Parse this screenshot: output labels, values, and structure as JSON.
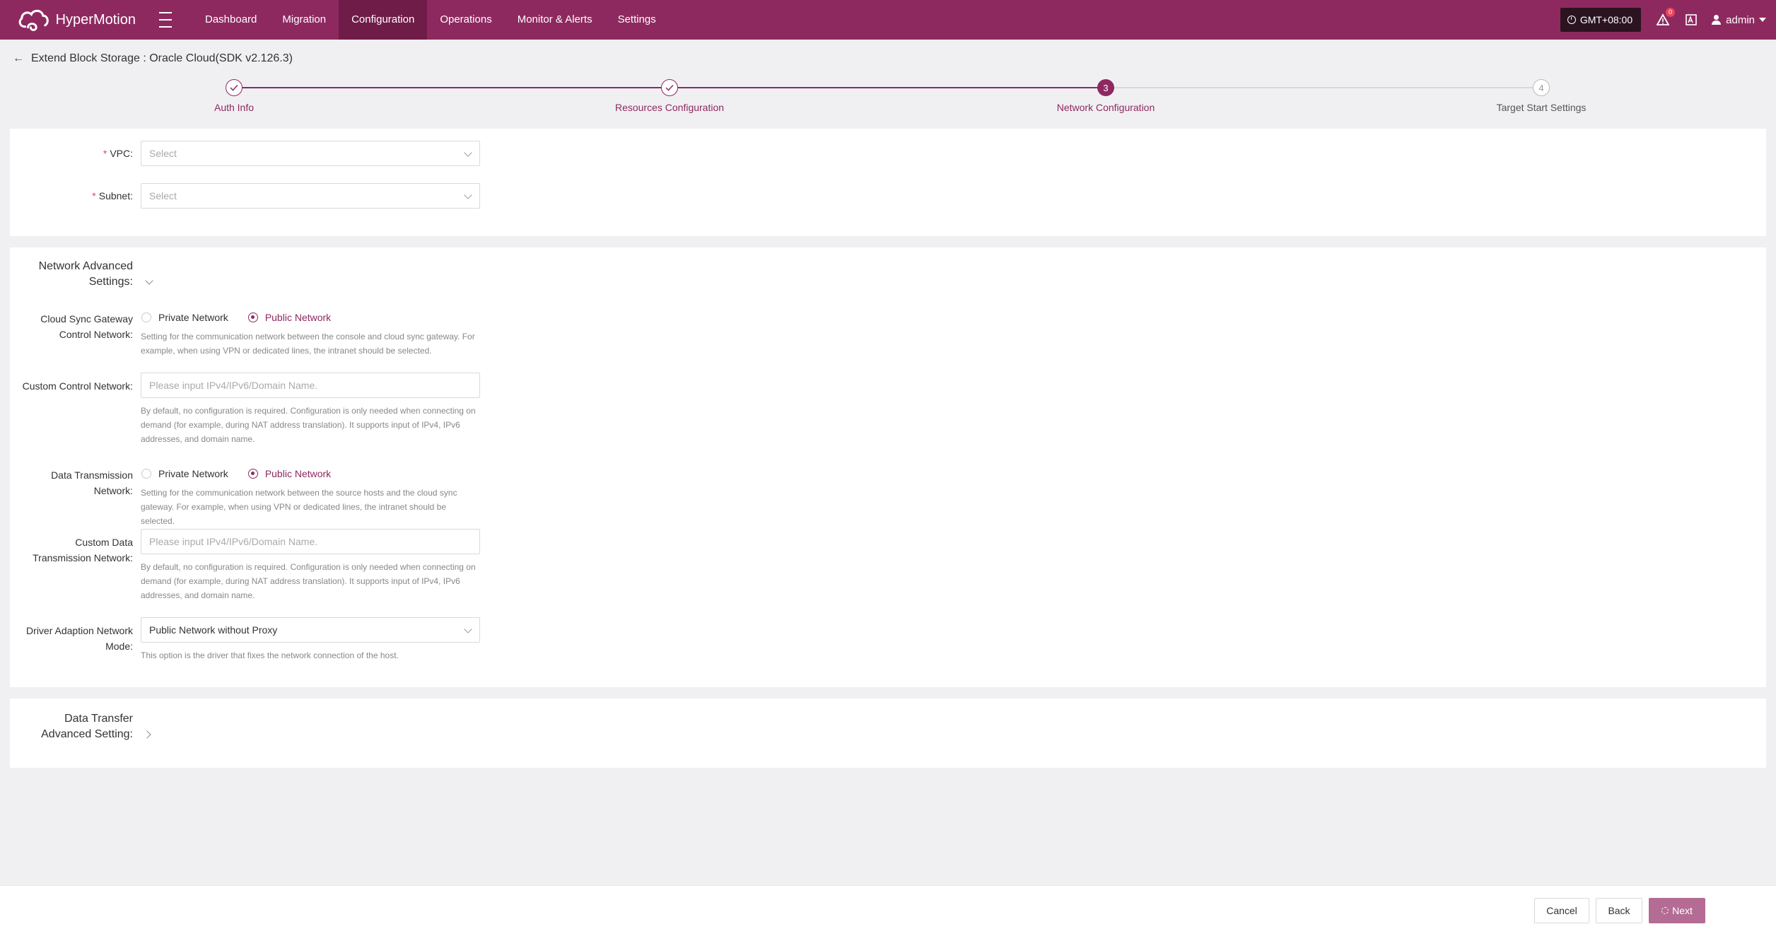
{
  "app": {
    "name": "HyperMotion"
  },
  "nav": {
    "items": [
      {
        "label": "Dashboard"
      },
      {
        "label": "Migration"
      },
      {
        "label": "Configuration"
      },
      {
        "label": "Operations"
      },
      {
        "label": "Monitor & Alerts"
      },
      {
        "label": "Settings"
      }
    ],
    "active": "Configuration"
  },
  "topbar": {
    "timezone": "GMT+08:00",
    "alert_count": "0",
    "user": "admin",
    "lang_icon": "A"
  },
  "page": {
    "title": "Extend Block Storage : Oracle Cloud(SDK v2.126.3)"
  },
  "steps": [
    {
      "number": "1",
      "label": "Auth Info",
      "status": "done"
    },
    {
      "number": "2",
      "label": "Resources Configuration",
      "status": "done"
    },
    {
      "number": "3",
      "label": "Network Configuration",
      "status": "active"
    },
    {
      "number": "4",
      "label": "Target Start Settings",
      "status": "todo"
    }
  ],
  "network": {
    "vpc_label": "VPC:",
    "vpc_placeholder": "Select",
    "subnet_label": "Subnet:",
    "subnet_placeholder": "Select"
  },
  "advanced": {
    "title_line1": "Network Advanced",
    "title_line2": "Settings:",
    "gateway_label_line1": "Cloud Sync Gateway",
    "gateway_label_line2": "Control Network:",
    "private_label": "Private Network",
    "public_label": "Public Network",
    "gateway_hint": "Setting for the communication network between the console and cloud sync gateway. For example, when using VPN or dedicated lines, the intranet should be selected.",
    "custom_control_label": "Custom Control Network:",
    "input_placeholder": "Please input IPv4/IPv6/Domain Name.",
    "custom_hint": "By default, no configuration is required. Configuration is only needed when connecting on demand (for example, during NAT address translation). It supports input of IPv4, IPv6 addresses, and domain name.",
    "data_trans_label_line1": "Data Transmission",
    "data_trans_label_line2": "Network:",
    "data_trans_hint": "Setting for the communication network between the source hosts and the cloud sync gateway. For example, when using VPN or dedicated lines, the intranet should be selected.",
    "custom_data_label_line1": "Custom Data",
    "custom_data_label_line2": "Transmission Network:",
    "driver_label_line1": "Driver Adaption Network",
    "driver_label_line2": "Mode:",
    "driver_value": "Public Network without Proxy",
    "driver_hint": "This option is the driver that fixes the network connection of the host."
  },
  "transfer": {
    "title_line1": "Data Transfer",
    "title_line2": "Advanced Setting:"
  },
  "footer": {
    "cancel": "Cancel",
    "back": "Back",
    "next": "Next"
  },
  "colors": {
    "brand": "#8e2960",
    "brand_dark": "#6f1c48",
    "next_button": "#b46c94"
  }
}
